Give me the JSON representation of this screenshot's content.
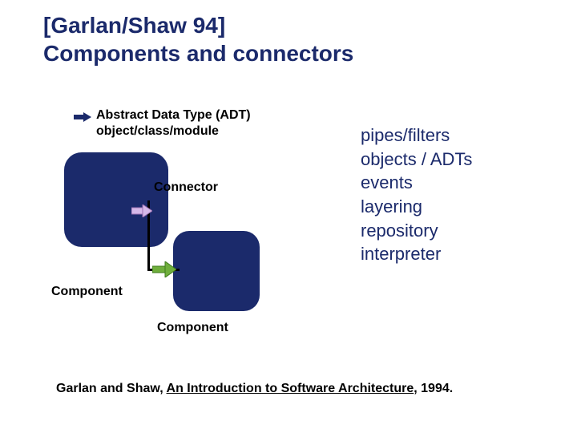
{
  "title_line1": "[Garlan/Shaw 94]",
  "title_line2": "Components and connectors",
  "adt_line1": "Abstract Data Type (ADT)",
  "adt_line2": "object/class/module",
  "connector_label": "Connector",
  "component_label_1": "Component",
  "component_label_2": "Component",
  "styles_list": [
    "pipes/filters",
    "objects / ADTs",
    "events",
    "layering",
    "repository",
    "interpreter"
  ],
  "citation_prefix": "Garlan and Shaw, ",
  "citation_title": "An Introduction to Software Architecture",
  "citation_suffix": ", 1994.",
  "colors": {
    "primary": "#1b2a6b",
    "arrow_lavender_fill": "#d5b8e8",
    "arrow_lavender_stroke": "#9a6fb0",
    "arrow_green_fill": "#6fae3c",
    "arrow_green_stroke": "#3f7a1d"
  }
}
